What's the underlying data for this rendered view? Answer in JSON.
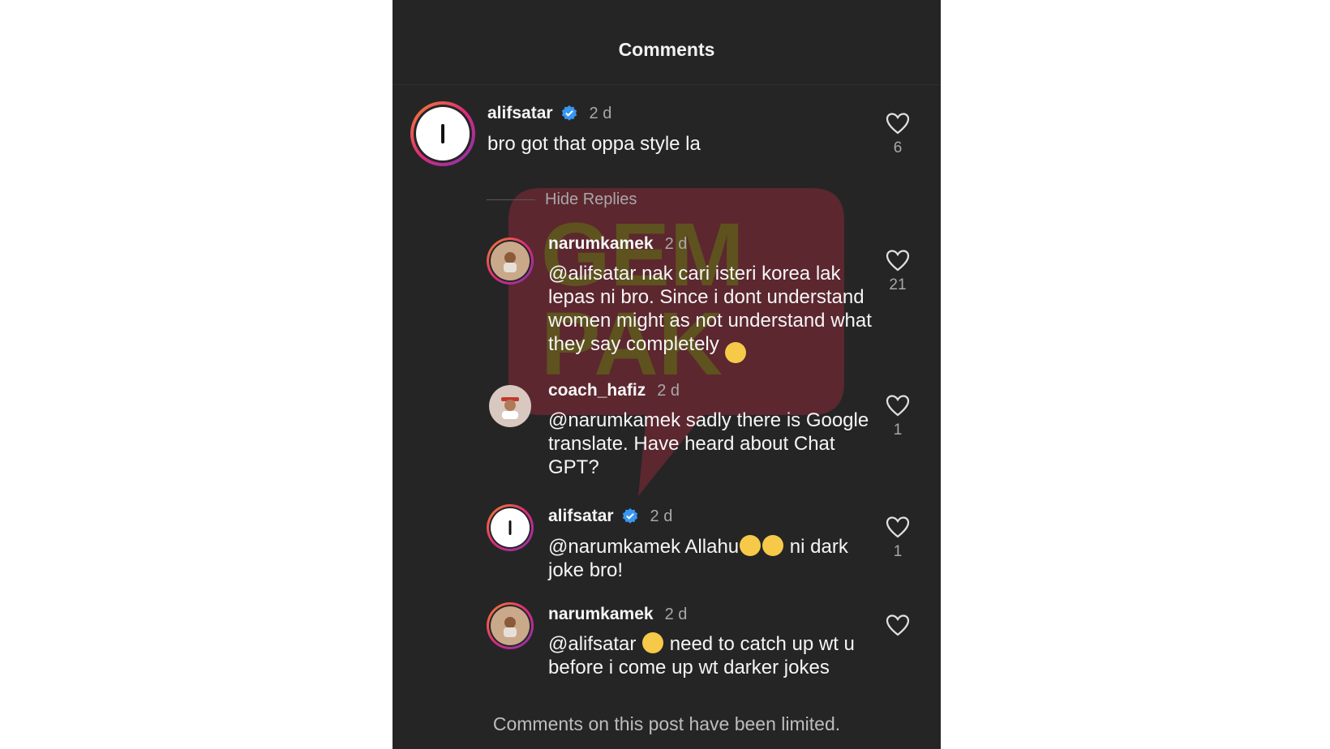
{
  "header": {
    "title": "Comments"
  },
  "comments": [
    {
      "username": "alifsatar",
      "verified": true,
      "time": "2 d",
      "text": "bro got that oppa style la",
      "likes": "6"
    }
  ],
  "hide_replies_label": "Hide Replies",
  "replies": [
    {
      "username": "narumkamek",
      "verified": false,
      "time": "2 d",
      "text": "@alifsatar nak cari isteri korea lak lepas ni bro. Since i dont understand women might as not understand what they say completely",
      "emoji_after": "🫣",
      "likes": "21"
    },
    {
      "username": "coach_hafiz",
      "verified": false,
      "time": "2 d",
      "text": "@narumkamek sadly there is Google translate. Have heard about Chat GPT?",
      "likes": "1"
    },
    {
      "username": "alifsatar",
      "verified": true,
      "time": "2 d",
      "text_before": "@narumkamek Allahu",
      "text_after": " ni dark joke bro!",
      "likes": "1"
    },
    {
      "username": "narumkamek",
      "verified": false,
      "time": "2 d",
      "text_before": "@alifsatar ",
      "text_after": " need to catch up wt u before i come up wt darker jokes",
      "likes": ""
    }
  ],
  "footer": {
    "text": "Comments on this post have been limited."
  },
  "watermark": {
    "text_line1": "GEM",
    "text_line2": "PAK"
  },
  "colors": {
    "background": "#252526",
    "verified": "#3897f0",
    "watermark": "#8b2a36"
  }
}
